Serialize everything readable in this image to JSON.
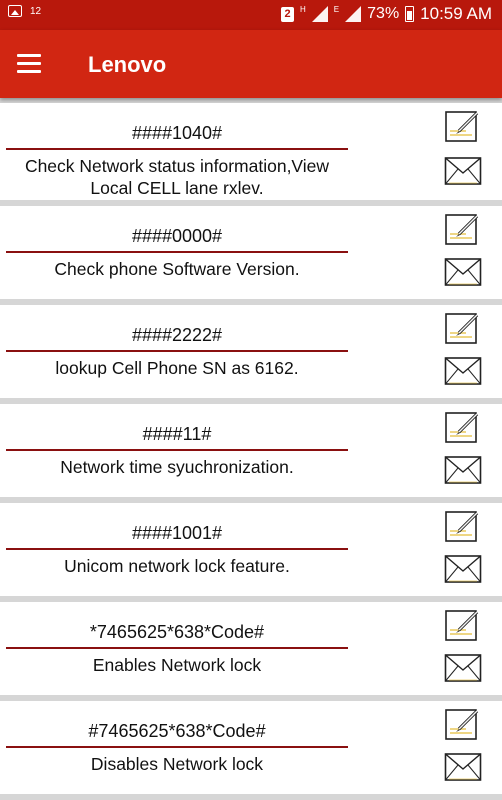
{
  "status_bar": {
    "notification_count": "12",
    "sim_badge": "2",
    "network_h": "H",
    "network_e": "E",
    "battery": "73%",
    "time": "10:59 AM"
  },
  "app_bar": {
    "title": "Lenovo"
  },
  "codes": [
    {
      "code": "####1040#",
      "description": "Check Network status information,View Local CELL lane rxlev."
    },
    {
      "code": "####0000#",
      "description": "Check phone Software Version."
    },
    {
      "code": "####2222#",
      "description": "lookup Cell Phone SN as 6162."
    },
    {
      "code": "####11#",
      "description": "Network time syuchronization."
    },
    {
      "code": "####1001#",
      "description": "Unicom network lock feature."
    },
    {
      "code": "*7465625*638*Code#",
      "description": "Enables Network lock"
    },
    {
      "code": "#7465625*638*Code#",
      "description": "Disables Network lock"
    }
  ],
  "icons": {
    "edit": "edit-note-icon",
    "mail": "envelope-icon"
  },
  "colors": {
    "status_bar": "#b8180c",
    "app_bar": "#d12612",
    "rule": "#8a1010",
    "separator": "#d6d6d6"
  }
}
